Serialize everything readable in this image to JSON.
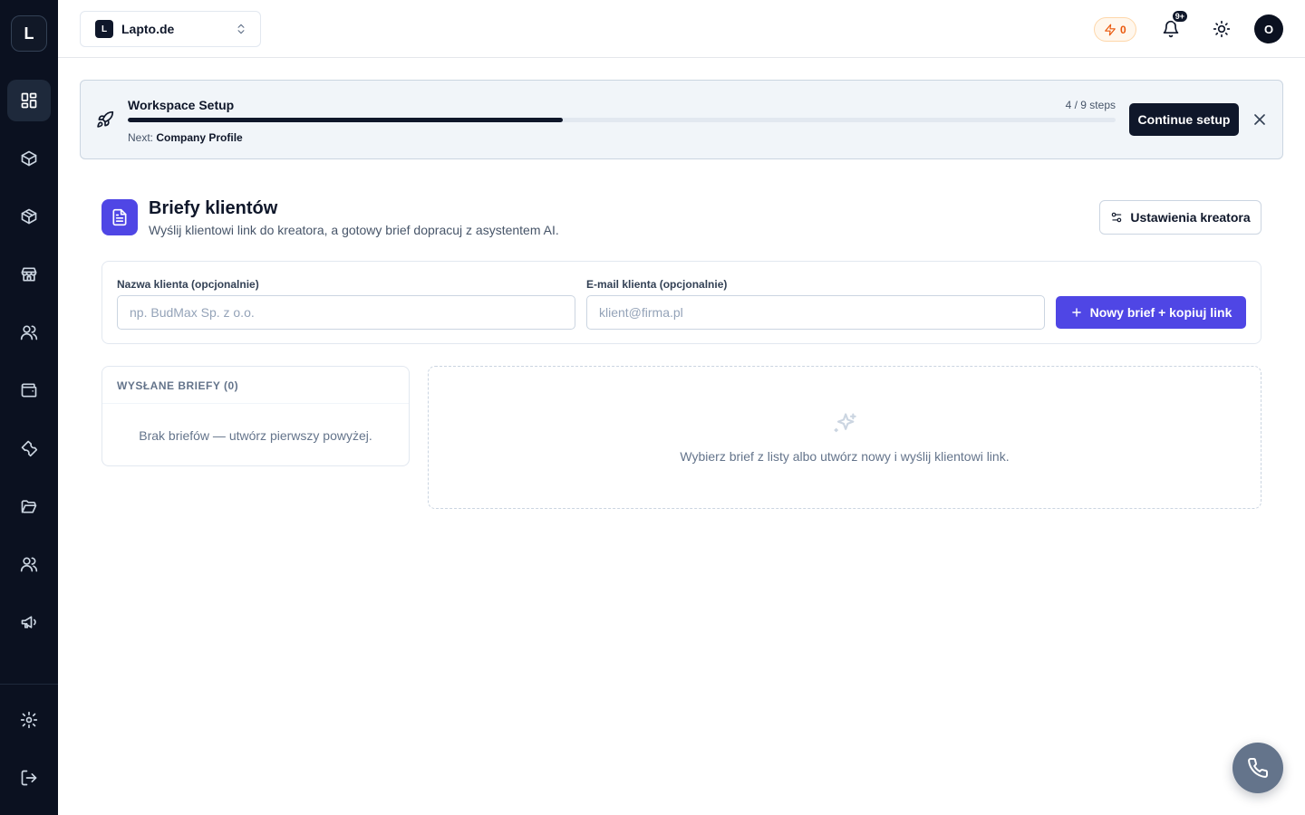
{
  "sidebar": {
    "logo_letter": "L",
    "items": [
      {
        "icon": "dashboard-icon",
        "active": true
      },
      {
        "icon": "box-icon"
      },
      {
        "icon": "package-icon"
      },
      {
        "icon": "store-icon"
      },
      {
        "icon": "users-icon"
      },
      {
        "icon": "wallet-icon"
      },
      {
        "icon": "wrench-icon"
      },
      {
        "icon": "folder-open-icon"
      },
      {
        "icon": "team-icon"
      },
      {
        "icon": "megaphone-icon"
      },
      {
        "icon": "settings-icon"
      },
      {
        "icon": "logout-icon"
      }
    ]
  },
  "topbar": {
    "workspace_badge": "L",
    "workspace_name": "Lapto.de",
    "credits": "0",
    "notifications_badge": "9+",
    "avatar_letter": "O"
  },
  "setup": {
    "title": "Workspace Setup",
    "steps": "4 / 9 steps",
    "progress": 0.44,
    "next_label": "Next:",
    "next_value": "Company Profile",
    "continue_label": "Continue setup"
  },
  "page": {
    "title": "Briefy klientów",
    "subtitle": "Wyślij klientowi link do kreatora, a gotowy brief dopracuj z asystentem AI.",
    "settings_label": "Ustawienia kreatora"
  },
  "form": {
    "name_label": "Nazwa klienta (opcjonalnie)",
    "name_placeholder": "np. BudMax Sp. z o.o.",
    "name_value": "",
    "email_label": "E-mail klienta (opcjonalnie)",
    "email_placeholder": "klient@firma.pl",
    "email_value": "",
    "submit_label": "Nowy brief + kopiuj link"
  },
  "sent": {
    "header": "WYSŁANE BRIEFY (0)",
    "empty": "Brak briefów — utwórz pierwszy powyżej."
  },
  "detail": {
    "empty": "Wybierz brief z listy albo utwórz nowy i wyślij klientowi link."
  },
  "colors": {
    "sidebar_bg": "#0b1120",
    "accent": "#4f46e5",
    "dark": "#0f172a",
    "credits_orange": "#ea580c"
  }
}
